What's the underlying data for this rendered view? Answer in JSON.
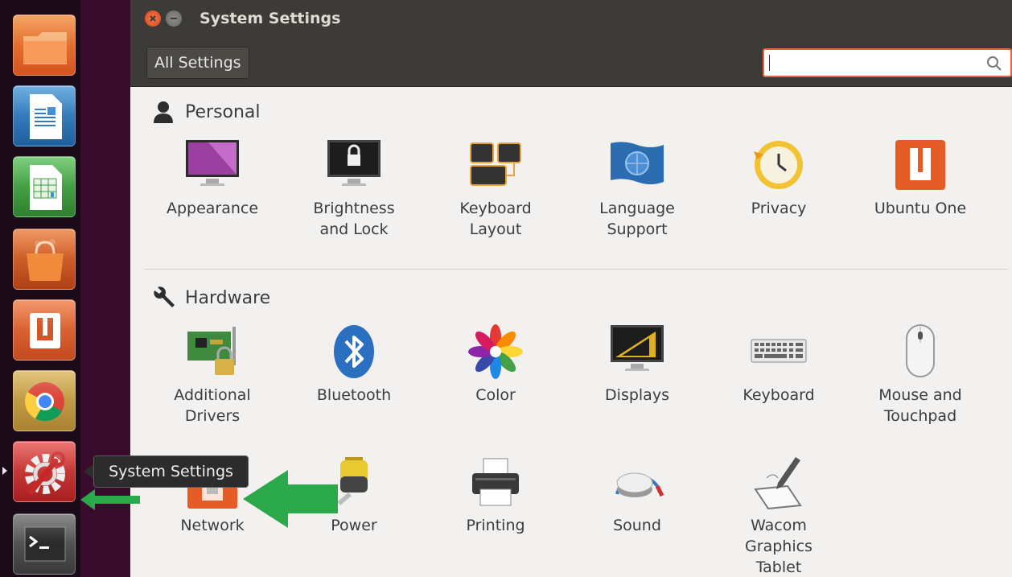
{
  "window": {
    "title": "System Settings",
    "all_settings_label": "All Settings",
    "search": {
      "value": "",
      "placeholder": "",
      "icon": "search-icon"
    }
  },
  "launcher": {
    "items": [
      {
        "name": "files",
        "icon": "folder-icon",
        "color": "#e2622b"
      },
      {
        "name": "writer",
        "icon": "libreoffice-writer-icon",
        "color": "#2f79c3"
      },
      {
        "name": "calc",
        "icon": "libreoffice-calc-icon",
        "color": "#3e9c3e"
      },
      {
        "name": "software-center",
        "icon": "shopping-bag-icon",
        "color": "#c74d22"
      },
      {
        "name": "ubuntu-one",
        "icon": "ubuntu-one-icon",
        "color": "#d35426"
      },
      {
        "name": "chrome",
        "icon": "chrome-icon",
        "color": "#c79c3b"
      },
      {
        "name": "system-settings",
        "icon": "gear-wrench-icon",
        "color": "#c63331"
      },
      {
        "name": "terminal",
        "icon": "terminal-icon",
        "color": "#5a5a5a"
      }
    ],
    "tooltip": "System Settings"
  },
  "sections": {
    "personal": {
      "title": "Personal",
      "icon": "person-icon",
      "items": [
        {
          "label": "Appearance",
          "icon": "appearance-icon"
        },
        {
          "label": "Brightness\nand Lock",
          "icon": "brightness-lock-icon"
        },
        {
          "label": "Keyboard\nLayout",
          "icon": "keyboard-layout-icon"
        },
        {
          "label": "Language\nSupport",
          "icon": "language-support-icon"
        },
        {
          "label": "Privacy",
          "icon": "privacy-icon"
        },
        {
          "label": "Ubuntu One",
          "icon": "ubuntu-one-icon"
        }
      ]
    },
    "hardware": {
      "title": "Hardware",
      "icon": "wrench-icon",
      "items": [
        {
          "label": "Additional\nDrivers",
          "icon": "additional-drivers-icon"
        },
        {
          "label": "Bluetooth",
          "icon": "bluetooth-icon"
        },
        {
          "label": "Color",
          "icon": "color-icon"
        },
        {
          "label": "Displays",
          "icon": "displays-icon"
        },
        {
          "label": "Keyboard",
          "icon": "keyboard-icon"
        },
        {
          "label": "Mouse and\nTouchpad",
          "icon": "mouse-icon"
        },
        {
          "label": "Network",
          "icon": "network-icon"
        },
        {
          "label": "Power",
          "icon": "power-icon"
        },
        {
          "label": "Printing",
          "icon": "printer-icon"
        },
        {
          "label": "Sound",
          "icon": "sound-icon"
        },
        {
          "label": "Wacom\nGraphics\nTablet",
          "icon": "wacom-tablet-icon"
        }
      ]
    }
  },
  "annotations": {
    "arrow_color": "#2aa84a"
  }
}
